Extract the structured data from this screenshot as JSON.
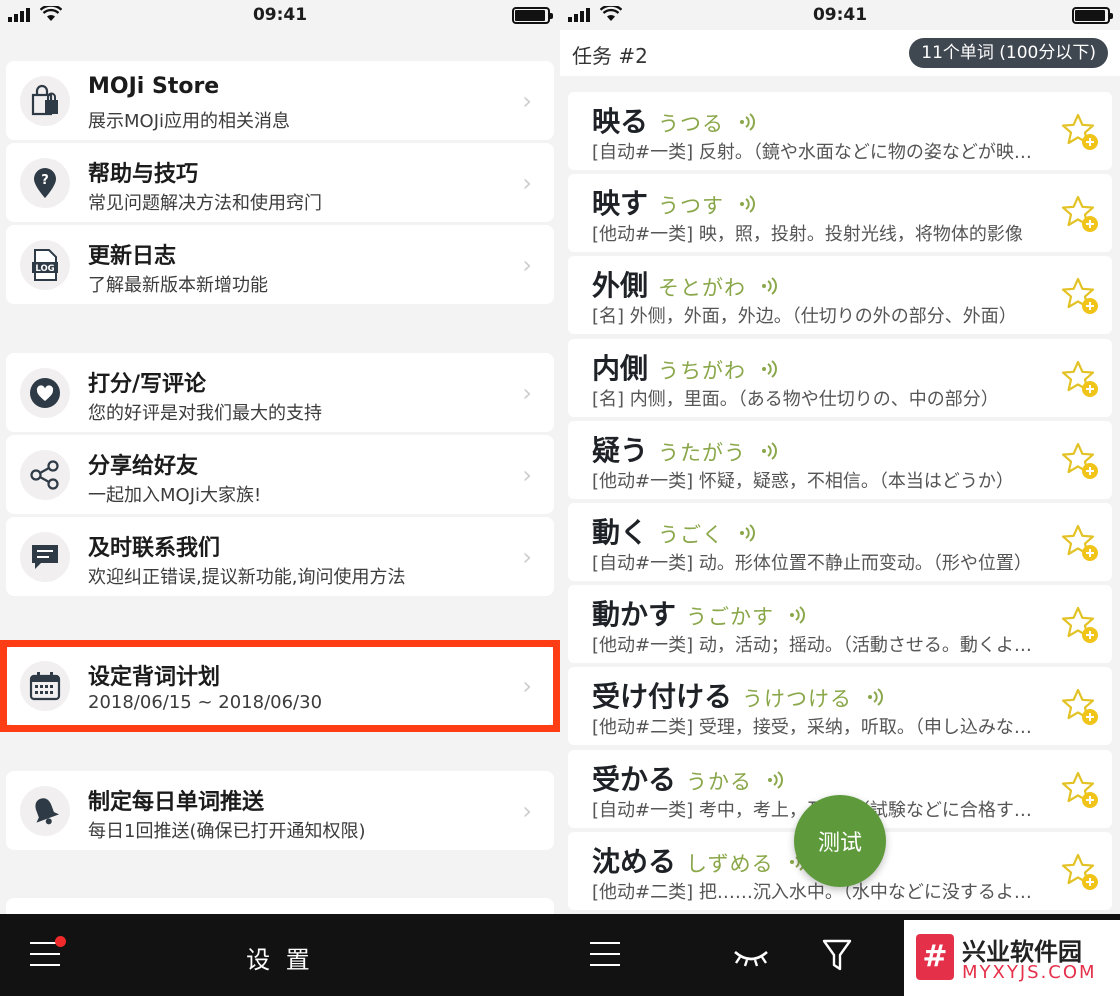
{
  "left": {
    "status_time": "09:41",
    "items": [
      {
        "title": "MOJi Store",
        "sub": "展示MOJi应用的相关消息",
        "icon": "store-bag-icon"
      },
      {
        "title": "帮助与技巧",
        "sub": "常见问题解决方法和使用窍门",
        "icon": "location-pin-icon"
      },
      {
        "title": "更新日志",
        "sub": "了解最新版本新增功能",
        "icon": "log-file-icon"
      },
      {
        "title": "打分/写评论",
        "sub": "您的好评是对我们最大的支持",
        "icon": "heart-icon"
      },
      {
        "title": "分享给好友",
        "sub": "一起加入MOJi大家族!",
        "icon": "share-icon"
      },
      {
        "title": "及时联系我们",
        "sub": "欢迎纠正错误,提议新功能,询问使用方法",
        "icon": "message-icon"
      },
      {
        "title": "设定背词计划",
        "sub": "2018/06/15 ~ 2018/06/30",
        "icon": "calendar-icon"
      },
      {
        "title": "制定每日单词推送",
        "sub": "每日1回推送(确保已打开通知权限)",
        "icon": "bell-icon"
      }
    ],
    "tabbar_title": "设 置"
  },
  "right": {
    "status_time": "09:41",
    "task_title": "任务 #2",
    "task_badge": "11个单词 (100分以下)",
    "words": [
      {
        "word": "映る",
        "kana": "うつる",
        "def": "[自动#一类] 反射。（鏡や水面などに物の姿などが映る）"
      },
      {
        "word": "映す",
        "kana": "うつす",
        "def": "[他动#一类] 映，照，投射。投射光线，将物体的影像"
      },
      {
        "word": "外側",
        "kana": "そとがわ",
        "def": "[名] 外侧，外面，外边。（仕切りの外の部分、外面）"
      },
      {
        "word": "内側",
        "kana": "うちがわ",
        "def": "[名] 内侧，里面。（ある物や仕切りの、中の部分）"
      },
      {
        "word": "疑う",
        "kana": "うたがう",
        "def": "[他动#一类] 怀疑，疑惑，不相信。（本当はどうか）"
      },
      {
        "word": "動く",
        "kana": "うごく",
        "def": "[自动#一类] 动。形体位置不静止而变动。（形や位置）"
      },
      {
        "word": "動かす",
        "kana": "うごかす",
        "def": "[他动#一类] 动，活动；摇动。（活動させる。動くように）"
      },
      {
        "word": "受け付ける",
        "kana": "うけつける",
        "def": "[他动#二类] 受理，接受，采纳，听取。（申し込みなど）"
      },
      {
        "word": "受かる",
        "kana": "うかる",
        "def": "[自动#一类] 考中，考上，及格。（試験などに合格する）"
      },
      {
        "word": "沈める",
        "kana": "しずめる",
        "def": "[他动#二类] 把……沉入水中。（水中などに没するように）"
      }
    ],
    "fab_label": "测试"
  },
  "watermark": {
    "logo": "#",
    "title": "兴业软件园",
    "url": "MYXYJS.COM"
  }
}
